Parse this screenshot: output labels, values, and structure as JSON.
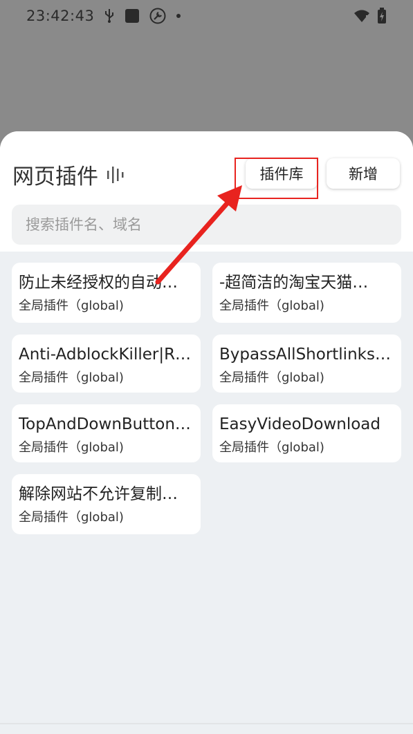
{
  "status_bar": {
    "time": "23:42:43",
    "icons": [
      "usb-icon",
      "square-icon",
      "wrench-icon",
      "dot-icon",
      "wifi-icon",
      "battery-icon"
    ]
  },
  "sheet": {
    "title": "网页插件",
    "title_icon": "sound-bars-icon",
    "library_button": "插件库",
    "add_button": "新增",
    "search_placeholder": "搜索插件名、域名"
  },
  "plugins": [
    {
      "name": "防止未经授权的自动…",
      "type": "全局插件（global)"
    },
    {
      "name": "-超简洁的淘宝天猫…",
      "type": "全局插件（global)"
    },
    {
      "name": "Anti-AdblockKiller|R…",
      "type": "全局插件（global)"
    },
    {
      "name": "BypassAllShortlinks…",
      "type": "全局插件（global)"
    },
    {
      "name": "TopAndDownButton…",
      "type": "全局插件（global)"
    },
    {
      "name": "EasyVideoDownload",
      "type": "全局插件（global)"
    },
    {
      "name": "解除网站不允许复制…",
      "type": "全局插件（global)"
    }
  ],
  "colors": {
    "overlay": "#8a8a8a",
    "highlight": "#e8231f",
    "list_background": "#edf0f3"
  }
}
